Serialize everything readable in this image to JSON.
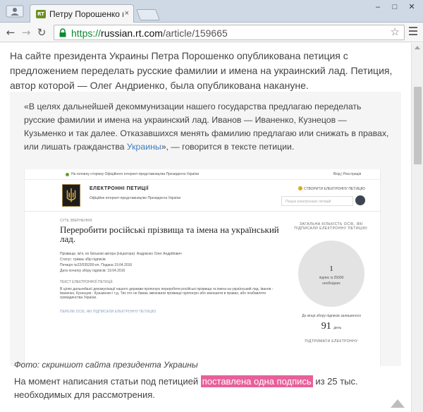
{
  "browser": {
    "tab_title": "Петру Порошенко предл",
    "tab_favicon_text": "RT",
    "close_glyph": "×",
    "url_scheme": "https://",
    "url_host": "russian.rt.com",
    "url_path": "/article/159665",
    "back_glyph": "←",
    "forward_glyph": "→",
    "reload_glyph": "↻",
    "star_glyph": "☆",
    "minimize_glyph": "–",
    "maximize_glyph": "□",
    "close_window_glyph": "✕"
  },
  "article": {
    "lead": "На сайте президента Украины Петра Порошенко опубликована петиция с предложением переделать русские фамилии и имена на украинский лад. Петиция, автор которой — Олег Андриенко, была опубликована накануне.",
    "quote_before": "«В целях дальнейшей декоммунизации нашего государства предлагаю переделать русские фамилии и имена на украинский лад. Иванов — Иваненко, Кузнецов — Кузьменко и так далее. Отказавшихся менять фамилию предлагаю или снижать в правах, или лишать гражданства ",
    "quote_link": "Украины",
    "quote_after": "», — говорится в тексте петиции.",
    "caption": "Фото: скриншот сайта президента Украины",
    "closing_before": "На момент написания статьи под петицией ",
    "closing_highlight": "поставлена одна подпись",
    "closing_after": " из 25 тыс. необходимых для рассмотрения."
  },
  "screenshot": {
    "topbar_home": "На головну сторінку Офіційного інтернет-представництва Президента України",
    "topbar_login": "Вхід | Реєстрація",
    "site_name": "ЕЛЕКТРОННІ ПЕТИЦІЇ",
    "site_sub": "Офіційне інтернет-представництво Президента України",
    "create_link": "СТВОРИТИ ЕЛЕКТРОННУ ПЕТИЦІЮ",
    "search_placeholder": "Пошук електронних петицій",
    "petition_label": "СУТЬ ЗВЕРНЕННЯ:",
    "petition_title": "Переробити російські прізвища та імена на український лад.",
    "meta_author": "Прізвище, ім'я, по батькові автора (ініціатора): Андрієнко Олег Андрійович",
    "meta_status": "Статус: триває збір підписів",
    "meta_number": "Петиція №22/035200-еп. Подана 19.04.2016",
    "meta_start": "Дата початку збору підписів: 19.04.2016",
    "text_label": "ТЕКСТ ЕЛЕКТРОННОЇ ПЕТИЦІЇ:",
    "text_body": "В цілях дальнейшої декомунізації нашого держави пропоную переробити російські прізвища та імена на український лад. Іванов - Іваненко, Кузнєцов - Кузьменко і т.д. Тих хто не бажає змінювати прізвище пропоную або зменшити в правах, або позбавляти громадянства України.",
    "signers_link": "ПЕРЕЛІК ОСІБ, ЯКІ ПІДПИСАЛИ ЕЛЕКТРОННУ ПЕТИЦІЮ",
    "side_title": "ЗАГАЛЬНА КІЛЬКІСТЬ ОСІБ, ЯКІ ПІДПИСАЛИ ЕЛЕКТРОННУ ПЕТИЦІЮ:",
    "signatures_count": "1",
    "signatures_of": "підпис із 25000",
    "signatures_needed": "необхідних",
    "days_left_label": "До кінця збору підписів залишилося",
    "days_left": "91",
    "days_unit": "день",
    "side_footer": "ПІДТРИМАТИ ЕЛЕКТРОННУ"
  }
}
